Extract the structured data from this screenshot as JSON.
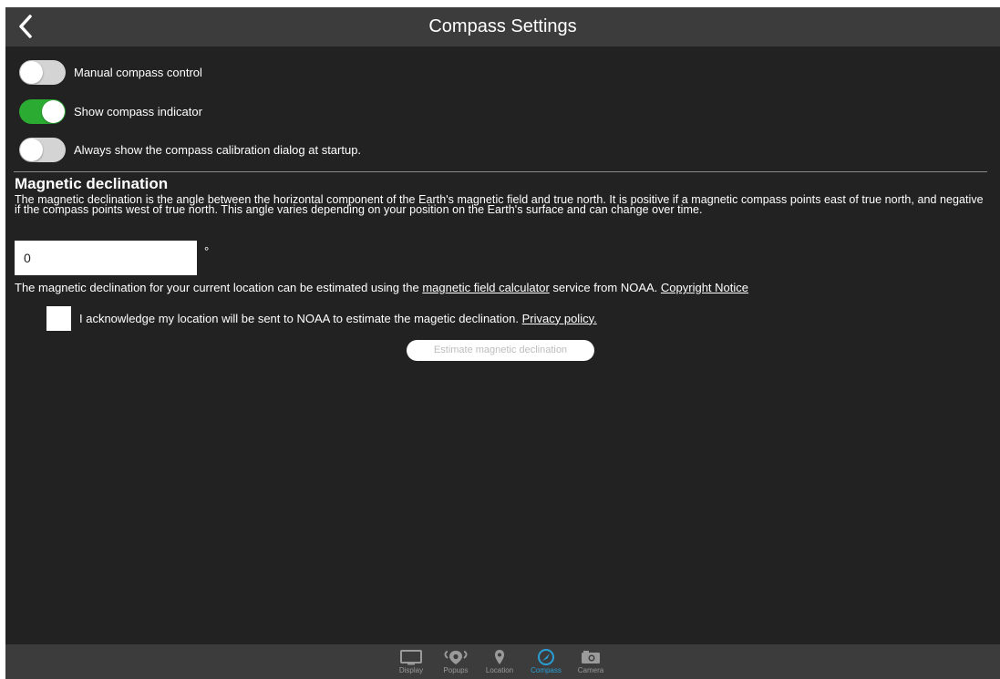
{
  "header": {
    "title": "Compass Settings",
    "back_icon": "chevron-left-icon"
  },
  "toggles": [
    {
      "label": "Manual compass control",
      "on": false
    },
    {
      "label": "Show compass indicator",
      "on": true
    },
    {
      "label": "Always show the compass calibration dialog at startup.",
      "on": false
    }
  ],
  "declination": {
    "title": "Magnetic declination",
    "description": "The magnetic declination is the angle between the horizontal component of the Earth's magnetic field and true north. It is positive if a magnetic compass points east of true north, and negative if the compass points west of true north. This angle varies depending on your position on the Earth's surface and can change over time.",
    "value": "0",
    "unit": "°",
    "estimate_note_prefix": "The magnetic declination for your current location can be estimated using the",
    "calculator_link": "magnetic field calculator",
    "estimate_note_suffix": "service from NOAA.",
    "copyright_link": "Copyright Notice",
    "acknowledge_text": "I acknowledge my location will be sent to NOAA to estimate the magetic declination.",
    "privacy_link": "Privacy policy.",
    "acknowledged": false,
    "estimate_button": "Estimate magnetic declination"
  },
  "tabs": [
    {
      "label": "Display",
      "icon": "display-icon",
      "active": false
    },
    {
      "label": "Popups",
      "icon": "popups-icon",
      "active": false
    },
    {
      "label": "Location",
      "icon": "location-pin-icon",
      "active": false
    },
    {
      "label": "Compass",
      "icon": "compass-icon",
      "active": true
    },
    {
      "label": "Camera",
      "icon": "camera-icon",
      "active": false
    }
  ],
  "colors": {
    "background": "#222222",
    "header": "#3c3c3c",
    "toggle_on": "#2cab32",
    "toggle_off": "#d4d4d4",
    "active_tab": "#2a9fd6",
    "inactive_tab": "#9a9a9a"
  }
}
